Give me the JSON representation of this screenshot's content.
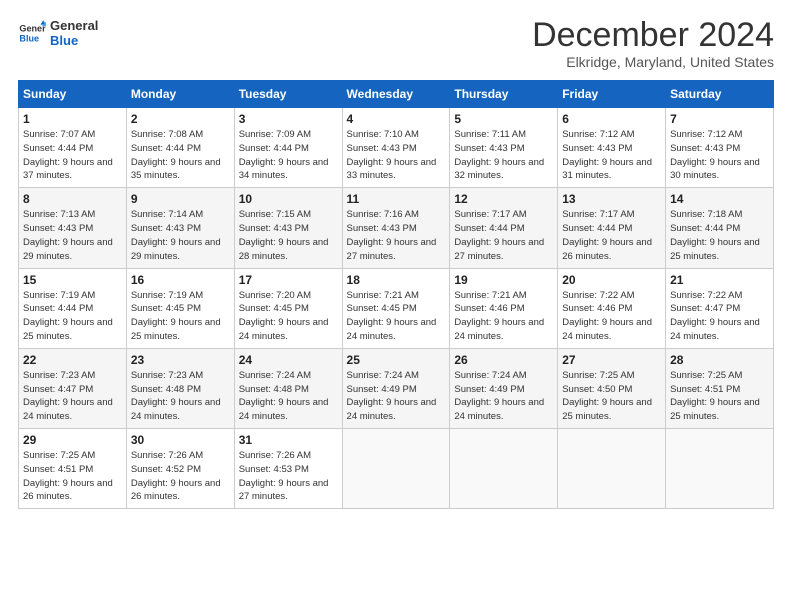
{
  "logo": {
    "line1": "General",
    "line2": "Blue"
  },
  "title": "December 2024",
  "location": "Elkridge, Maryland, United States",
  "days_header": [
    "Sunday",
    "Monday",
    "Tuesday",
    "Wednesday",
    "Thursday",
    "Friday",
    "Saturday"
  ],
  "weeks": [
    [
      {
        "day": "1",
        "sunrise": "7:07 AM",
        "sunset": "4:44 PM",
        "daylight": "9 hours and 37 minutes."
      },
      {
        "day": "2",
        "sunrise": "7:08 AM",
        "sunset": "4:44 PM",
        "daylight": "9 hours and 35 minutes."
      },
      {
        "day": "3",
        "sunrise": "7:09 AM",
        "sunset": "4:44 PM",
        "daylight": "9 hours and 34 minutes."
      },
      {
        "day": "4",
        "sunrise": "7:10 AM",
        "sunset": "4:43 PM",
        "daylight": "9 hours and 33 minutes."
      },
      {
        "day": "5",
        "sunrise": "7:11 AM",
        "sunset": "4:43 PM",
        "daylight": "9 hours and 32 minutes."
      },
      {
        "day": "6",
        "sunrise": "7:12 AM",
        "sunset": "4:43 PM",
        "daylight": "9 hours and 31 minutes."
      },
      {
        "day": "7",
        "sunrise": "7:12 AM",
        "sunset": "4:43 PM",
        "daylight": "9 hours and 30 minutes."
      }
    ],
    [
      {
        "day": "8",
        "sunrise": "7:13 AM",
        "sunset": "4:43 PM",
        "daylight": "9 hours and 29 minutes."
      },
      {
        "day": "9",
        "sunrise": "7:14 AM",
        "sunset": "4:43 PM",
        "daylight": "9 hours and 29 minutes."
      },
      {
        "day": "10",
        "sunrise": "7:15 AM",
        "sunset": "4:43 PM",
        "daylight": "9 hours and 28 minutes."
      },
      {
        "day": "11",
        "sunrise": "7:16 AM",
        "sunset": "4:43 PM",
        "daylight": "9 hours and 27 minutes."
      },
      {
        "day": "12",
        "sunrise": "7:17 AM",
        "sunset": "4:44 PM",
        "daylight": "9 hours and 27 minutes."
      },
      {
        "day": "13",
        "sunrise": "7:17 AM",
        "sunset": "4:44 PM",
        "daylight": "9 hours and 26 minutes."
      },
      {
        "day": "14",
        "sunrise": "7:18 AM",
        "sunset": "4:44 PM",
        "daylight": "9 hours and 25 minutes."
      }
    ],
    [
      {
        "day": "15",
        "sunrise": "7:19 AM",
        "sunset": "4:44 PM",
        "daylight": "9 hours and 25 minutes."
      },
      {
        "day": "16",
        "sunrise": "7:19 AM",
        "sunset": "4:45 PM",
        "daylight": "9 hours and 25 minutes."
      },
      {
        "day": "17",
        "sunrise": "7:20 AM",
        "sunset": "4:45 PM",
        "daylight": "9 hours and 24 minutes."
      },
      {
        "day": "18",
        "sunrise": "7:21 AM",
        "sunset": "4:45 PM",
        "daylight": "9 hours and 24 minutes."
      },
      {
        "day": "19",
        "sunrise": "7:21 AM",
        "sunset": "4:46 PM",
        "daylight": "9 hours and 24 minutes."
      },
      {
        "day": "20",
        "sunrise": "7:22 AM",
        "sunset": "4:46 PM",
        "daylight": "9 hours and 24 minutes."
      },
      {
        "day": "21",
        "sunrise": "7:22 AM",
        "sunset": "4:47 PM",
        "daylight": "9 hours and 24 minutes."
      }
    ],
    [
      {
        "day": "22",
        "sunrise": "7:23 AM",
        "sunset": "4:47 PM",
        "daylight": "9 hours and 24 minutes."
      },
      {
        "day": "23",
        "sunrise": "7:23 AM",
        "sunset": "4:48 PM",
        "daylight": "9 hours and 24 minutes."
      },
      {
        "day": "24",
        "sunrise": "7:24 AM",
        "sunset": "4:48 PM",
        "daylight": "9 hours and 24 minutes."
      },
      {
        "day": "25",
        "sunrise": "7:24 AM",
        "sunset": "4:49 PM",
        "daylight": "9 hours and 24 minutes."
      },
      {
        "day": "26",
        "sunrise": "7:24 AM",
        "sunset": "4:49 PM",
        "daylight": "9 hours and 24 minutes."
      },
      {
        "day": "27",
        "sunrise": "7:25 AM",
        "sunset": "4:50 PM",
        "daylight": "9 hours and 25 minutes."
      },
      {
        "day": "28",
        "sunrise": "7:25 AM",
        "sunset": "4:51 PM",
        "daylight": "9 hours and 25 minutes."
      }
    ],
    [
      {
        "day": "29",
        "sunrise": "7:25 AM",
        "sunset": "4:51 PM",
        "daylight": "9 hours and 26 minutes."
      },
      {
        "day": "30",
        "sunrise": "7:26 AM",
        "sunset": "4:52 PM",
        "daylight": "9 hours and 26 minutes."
      },
      {
        "day": "31",
        "sunrise": "7:26 AM",
        "sunset": "4:53 PM",
        "daylight": "9 hours and 27 minutes."
      },
      null,
      null,
      null,
      null
    ]
  ],
  "labels": {
    "sunrise": "Sunrise:",
    "sunset": "Sunset:",
    "daylight": "Daylight:"
  }
}
